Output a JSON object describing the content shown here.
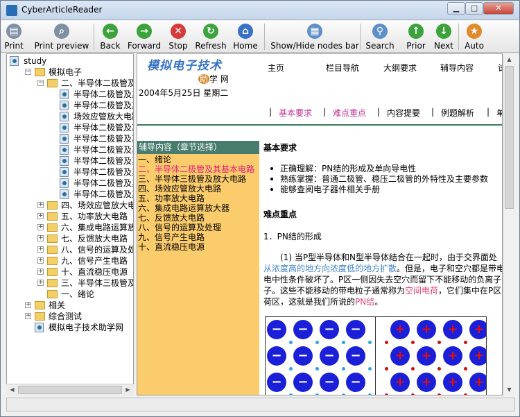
{
  "window": {
    "title": "CyberArticleReader"
  },
  "toolbar": [
    {
      "label": "Print",
      "icon": "printer-icon",
      "color": "#7f8fa4"
    },
    {
      "label": "Print preview",
      "icon": "print-preview-icon",
      "color": "#7f8fa4"
    },
    {
      "label": "Back",
      "icon": "back-arrow-icon",
      "color": "#3ca33c"
    },
    {
      "label": "Forward",
      "icon": "forward-arrow-icon",
      "color": "#3ca33c"
    },
    {
      "label": "Stop",
      "icon": "stop-icon",
      "color": "#d63a3a"
    },
    {
      "label": "Refresh",
      "icon": "refresh-icon",
      "color": "#3ca33c"
    },
    {
      "label": "Home",
      "icon": "home-icon",
      "color": "#3a6fc6"
    },
    {
      "label": "Show/Hide nodes bar",
      "icon": "nodes-bar-icon",
      "color": "#5e8fc7"
    },
    {
      "label": "Search",
      "icon": "search-icon",
      "color": "#5e8fc7"
    },
    {
      "label": "Prior",
      "icon": "prior-arrow-icon",
      "color": "#3ca33c"
    },
    {
      "label": "Next",
      "icon": "next-arrow-icon",
      "color": "#3ca33c"
    },
    {
      "label": "Auto",
      "icon": "auto-icon",
      "color": "#e08a2a"
    }
  ],
  "tree": [
    {
      "text": "study",
      "level": 0,
      "type": "book",
      "expander": ""
    },
    {
      "text": "模拟电子",
      "level": 1,
      "type": "folder",
      "expander": "−"
    },
    {
      "text": "二、半导体二极管及其",
      "level": 2,
      "type": "folder",
      "expander": "−"
    },
    {
      "text": "半导体二极管及其",
      "level": 3,
      "type": "page",
      "expander": ""
    },
    {
      "text": "半导体二极管及其",
      "level": 3,
      "type": "page",
      "expander": ""
    },
    {
      "text": "场效应管放大电路",
      "level": 3,
      "type": "page",
      "expander": ""
    },
    {
      "text": "半导体二极管及其",
      "level": 3,
      "type": "page",
      "expander": ""
    },
    {
      "text": "半导体二极管及其",
      "level": 3,
      "type": "page",
      "expander": ""
    },
    {
      "text": "半导体二极管及其",
      "level": 3,
      "type": "page",
      "expander": ""
    },
    {
      "text": "半导体二极管及其",
      "level": 3,
      "type": "page",
      "expander": ""
    },
    {
      "text": "半导体二极管及其",
      "level": 3,
      "type": "page",
      "expander": ""
    },
    {
      "text": "半导体二极管及其",
      "level": 3,
      "type": "page",
      "expander": ""
    },
    {
      "text": "半导体二极管及其",
      "level": 3,
      "type": "page",
      "expander": ""
    },
    {
      "text": "四、场效应管放大电路",
      "level": 2,
      "type": "folder",
      "expander": "+"
    },
    {
      "text": "五、功率放大电路",
      "level": 2,
      "type": "folder",
      "expander": "+"
    },
    {
      "text": "六、集成电路运算放大",
      "level": 2,
      "type": "folder",
      "expander": "+"
    },
    {
      "text": "七、反馈放大电路",
      "level": 2,
      "type": "folder",
      "expander": "+"
    },
    {
      "text": "八、信号的运算及处理",
      "level": 2,
      "type": "folder",
      "expander": "+"
    },
    {
      "text": "九、信号产生电路",
      "level": 2,
      "type": "folder",
      "expander": "+"
    },
    {
      "text": "十、直流稳压电源",
      "level": 2,
      "type": "folder",
      "expander": "+"
    },
    {
      "text": "三、半导体三极管及放",
      "level": 2,
      "type": "folder",
      "expander": "+"
    },
    {
      "text": "一、绪论",
      "level": 2,
      "type": "folder",
      "expander": ""
    },
    {
      "text": "相关",
      "level": 1,
      "type": "folder",
      "expander": "+"
    },
    {
      "text": "综合测试",
      "level": 1,
      "type": "folder",
      "expander": "+"
    },
    {
      "text": "模拟电子技术助学网",
      "level": 1,
      "type": "page",
      "expander": ""
    }
  ],
  "page": {
    "logo": "模拟电子技术",
    "logo_sub_help": "助",
    "logo_sub_rest": "学 网",
    "nav": [
      "主页",
      "栏目导航",
      "大纲要求",
      "辅导内容",
      "试"
    ],
    "date": "2004年5月25日 星期二",
    "subnav": [
      {
        "text": "基本要求",
        "color": "#c3339a"
      },
      {
        "text": "难点重点",
        "color": "#c3339a"
      },
      {
        "text": "内容提要",
        "color": "#000000"
      },
      {
        "text": "例题解析",
        "color": "#000000"
      },
      {
        "text": "单",
        "color": "#000000"
      }
    ],
    "panel": {
      "header": "辅导内容（章节选择）",
      "items": [
        {
          "text": "一、绪论",
          "color": "#000000"
        },
        {
          "text": "二、半导体二极管及其基本电路",
          "color": "#e0207a"
        },
        {
          "text": "三、半导体三极管及放大电路",
          "color": "#000000"
        },
        {
          "text": "四、场效应管放大电路",
          "color": "#000000"
        },
        {
          "text": "五、功率放大电路",
          "color": "#000000"
        },
        {
          "text": "六、集成电路运算放大器",
          "color": "#000000"
        },
        {
          "text": "七、反馈放大电路",
          "color": "#000000"
        },
        {
          "text": "八、信号的运算及处理",
          "color": "#000000"
        },
        {
          "text": "九、信号产生电路",
          "color": "#000000"
        },
        {
          "text": "十、直流稳压电源",
          "color": "#000000"
        }
      ]
    },
    "section1_title": "基本要求",
    "bullets": [
      "正确理解：PN结的形成及单向导电性",
      "熟练掌握：普通二极管、稳压二极管的外特性及主要参数",
      "能够查阅电子器件相关手册"
    ],
    "section2_title": "难点重点",
    "pn_heading": "1．PN结的形成",
    "para": {
      "l1": "(1) 当P型半导体和N型半导体结合在一起时，由于交界面处",
      "l2_blue": "从浓度高的地方向浓度低的地方扩散",
      "l2_rest": "。但是，电子和空穴都是带电",
      "l3": "电中性条件破坏了。P区一侧因失去空穴而留下不能移动的负离子",
      "l4_a": "子。这些不能移动的带电粒子通常称为",
      "l4_pink": "空间电荷",
      "l4_b": "，它们集中在P区",
      "l5_a": "荷区，这就是我们所说的",
      "l5_pink": "PN结",
      "l5_b": "。"
    },
    "figure": {
      "neg_sign": "−",
      "pos_sign": "+",
      "ion_color": "#1b1fd8",
      "hole_color": "#2aa7e0",
      "electron_color": "#d01010"
    }
  }
}
